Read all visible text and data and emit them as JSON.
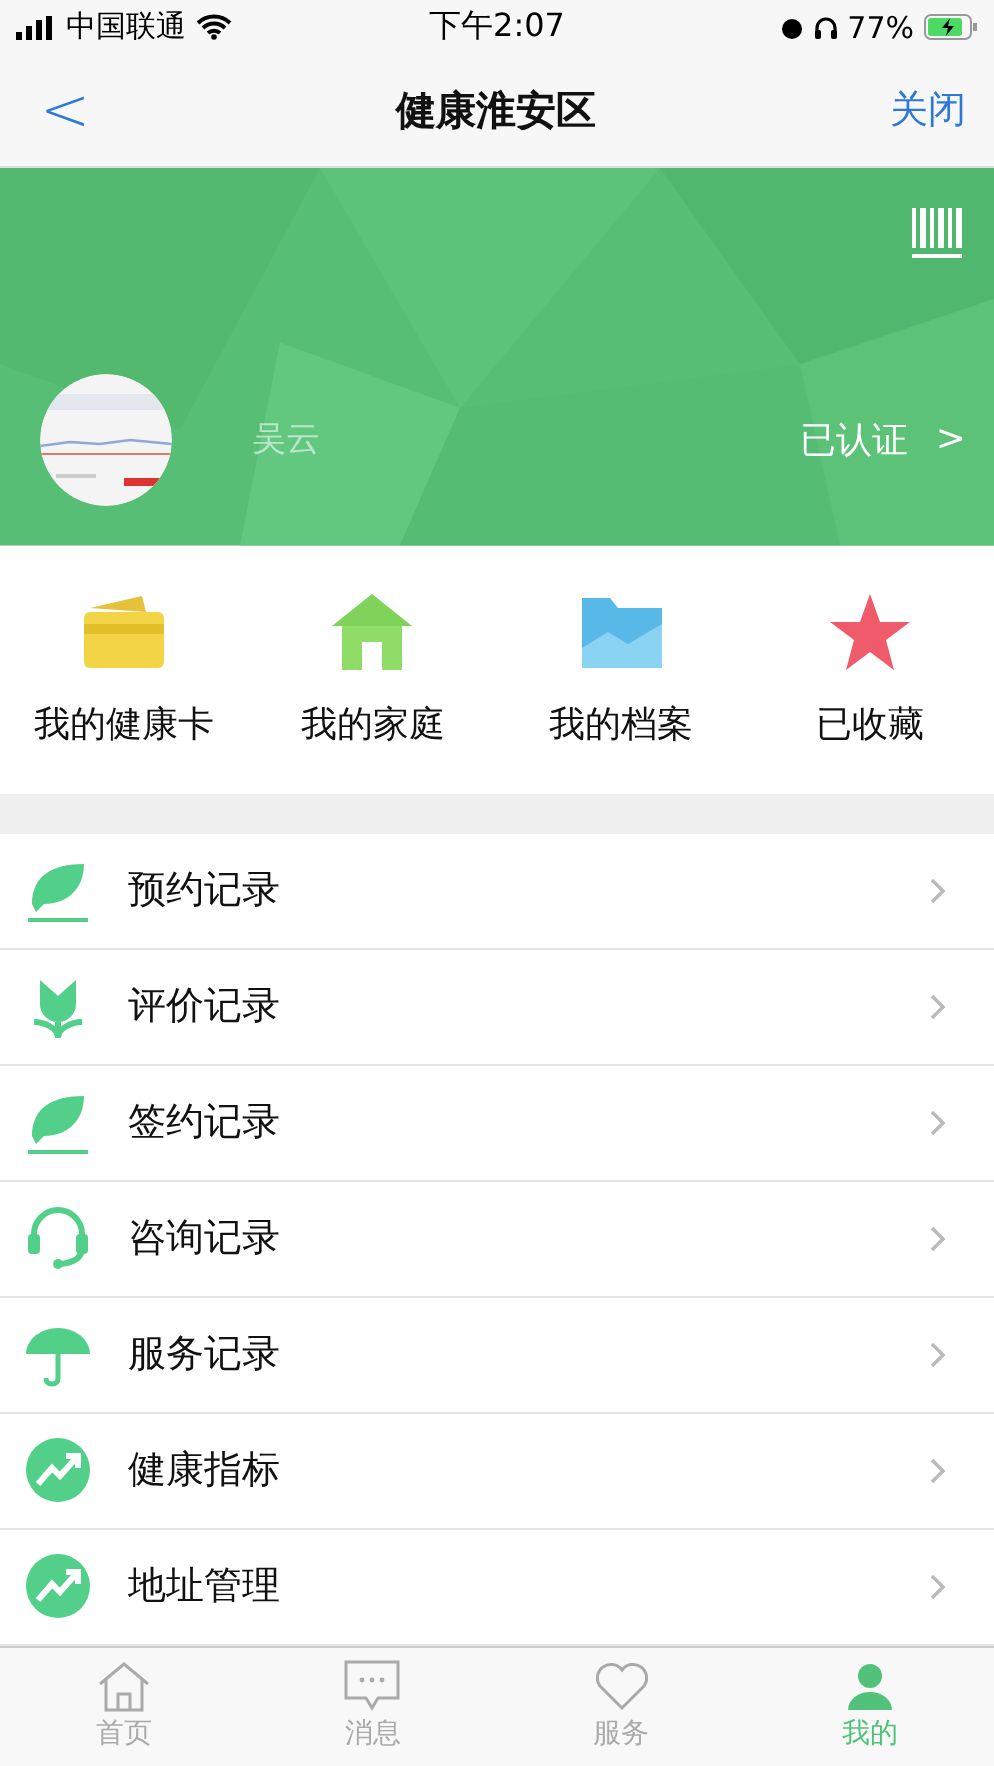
{
  "status_bar": {
    "carrier": "中国联通",
    "time": "下午2:07",
    "battery": "77%"
  },
  "nav": {
    "back": "<",
    "title": "健康淮安区",
    "close": "关闭"
  },
  "profile": {
    "name": "吴云",
    "verified": "已认证",
    "chevron": ">"
  },
  "shortcuts": [
    {
      "label": "我的健康卡"
    },
    {
      "label": "我的家庭"
    },
    {
      "label": "我的档案"
    },
    {
      "label": "已收藏"
    }
  ],
  "menu": [
    {
      "label": "预约记录"
    },
    {
      "label": "评价记录"
    },
    {
      "label": "签约记录"
    },
    {
      "label": "咨询记录"
    },
    {
      "label": "服务记录"
    },
    {
      "label": "健康指标"
    },
    {
      "label": "地址管理"
    }
  ],
  "tab_bar": [
    {
      "label": "首页",
      "selected": false
    },
    {
      "label": "消息",
      "selected": false
    },
    {
      "label": "服务",
      "selected": false
    },
    {
      "label": "我的",
      "selected": true
    }
  ]
}
